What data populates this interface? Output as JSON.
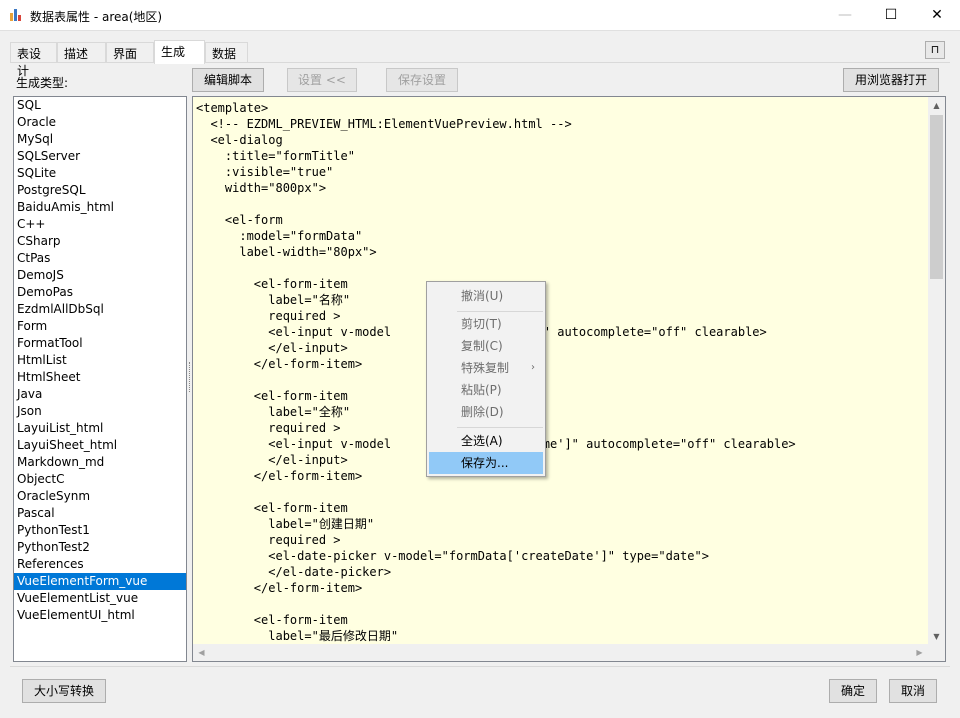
{
  "window": {
    "title": "数据表属性 - area(地区)",
    "minimize_glyph": "—",
    "maximize_glyph": "☐",
    "close_glyph": "✕"
  },
  "tabs": [
    "表设计",
    "描述",
    "界面",
    "生成",
    "数据"
  ],
  "active_tab": "生成",
  "pin_glyph": "⊓",
  "gen_type_label": "生成类型:",
  "toolbar": {
    "edit_script": "编辑脚本",
    "settings": "设置 <<",
    "save_settings": "保存设置",
    "open_browser": "用浏览器打开"
  },
  "gen_types": [
    "SQL",
    "Oracle",
    "MySql",
    "SQLServer",
    "SQLite",
    "PostgreSQL",
    "BaiduAmis_html",
    "C++",
    "CSharp",
    "CtPas",
    "DemoJS",
    "DemoPas",
    "EzdmlAllDbSql",
    "Form",
    "FormatTool",
    "HtmlList",
    "HtmlSheet",
    "Java",
    "Json",
    "LayuiList_html",
    "LayuiSheet_html",
    "Markdown_md",
    "ObjectC",
    "OracleSynm",
    "Pascal",
    "PythonTest1",
    "PythonTest2",
    "References",
    "VueElementForm_vue",
    "VueElementList_vue",
    "VueElementUI_html"
  ],
  "selected_gen_type": "VueElementForm_vue",
  "code_lines": [
    "<template>",
    "  <!-- EZDML_PREVIEW_HTML:ElementVuePreview.html -->",
    "  <el-dialog",
    "    :title=\"formTitle\"",
    "    :visible=\"true\"",
    "    width=\"800px\">",
    "",
    "    <el-form",
    "      :model=\"formData\"",
    "      label-width=\"80px\">",
    "",
    "        <el-form-item",
    "          label=\"名称\"",
    "          required >",
    "          <el-input v-model                  e']\" autocomplete=\"off\" clearable>",
    "          </el-input>",
    "        </el-form-item>",
    "",
    "        <el-form-item",
    "          label=\"全称\"",
    "          required >",
    "          <el-input v-model                  lName']\" autocomplete=\"off\" clearable>",
    "          </el-input>",
    "        </el-form-item>",
    "",
    "        <el-form-item",
    "          label=\"创建日期\"",
    "          required >",
    "          <el-date-picker v-model=\"formData['createDate']\" type=\"date\">",
    "          </el-date-picker>",
    "        </el-form-item>",
    "",
    "        <el-form-item",
    "          label=\"最后修改日期\""
  ],
  "context_menu": {
    "undo": "撤消(U)",
    "cut": "剪切(T)",
    "copy": "复制(C)",
    "special_copy": "特殊复制",
    "paste": "粘贴(P)",
    "delete": "删除(D)",
    "select_all": "全选(A)",
    "save_as": "保存为..."
  },
  "footer": {
    "case_convert": "大小写转换",
    "ok": "确定",
    "cancel": "取消"
  }
}
